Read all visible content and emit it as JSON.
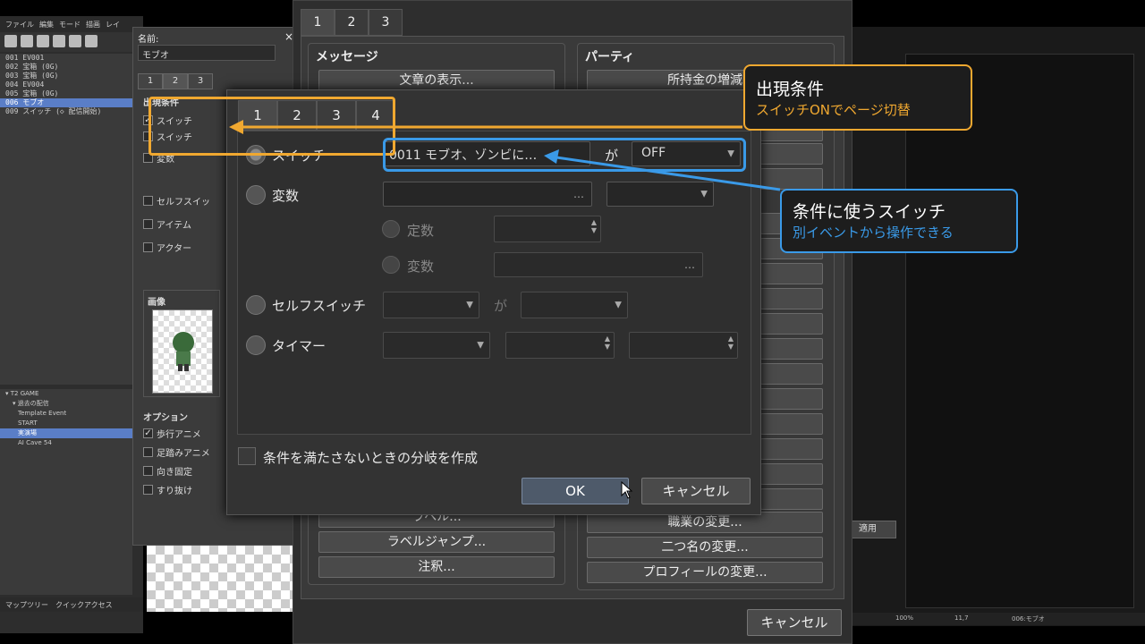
{
  "main_window": {
    "menu": [
      "ファイル",
      "編集",
      "モード",
      "描画",
      "レイ"
    ],
    "events": [
      "001 EV001",
      "002 宝箱 (0G)",
      "003 宝箱 (0G)",
      "004 EV004",
      "005 宝箱 (0G)",
      "006 モブオ",
      "009 スイッチ (◇ 配信開始)"
    ],
    "selected_event_index": 5,
    "tree": [
      "T2 GAME",
      "過去の配信",
      "Template Event",
      "START",
      "実演場",
      "AI Cave 54"
    ],
    "selected_tree_index": 4,
    "bottom_tabs": [
      "マップツリー",
      "クイックアクセス"
    ]
  },
  "event_editor": {
    "name_label": "名前:",
    "name_value": "モブオ",
    "close": "×",
    "page_tabs": [
      "1",
      "2",
      "3"
    ],
    "conditions_title": "出現条件",
    "conditions": [
      {
        "label": "スイッチ",
        "checked": true
      },
      {
        "label": "スイッチ",
        "checked": false
      },
      {
        "label": "変数",
        "checked": false
      },
      {
        "label": "セルフスイッ",
        "checked": false
      },
      {
        "label": "アイテム",
        "checked": false
      },
      {
        "label": "アクター",
        "checked": false
      }
    ],
    "image_title": "画像",
    "options_title": "オプション",
    "options": [
      {
        "label": "歩行アニメ",
        "checked": true
      },
      {
        "label": "足踏みアニメ",
        "checked": false
      },
      {
        "label": "向き固定",
        "checked": false
      },
      {
        "label": "すり抜け",
        "checked": false
      }
    ]
  },
  "command_dialog": {
    "tabs": [
      "1",
      "2",
      "3"
    ],
    "message_group": "メッセージ",
    "party_group": "パーティ",
    "left_buttons_top": [
      "文章の表示..."
    ],
    "right_buttons_top": [
      "所持金の増減"
    ],
    "left_buttons_bottom": [
      "ラベル...",
      "ラベルジャンプ...",
      "注釈..."
    ],
    "right_buttons_bottom": [
      "職業の変更...",
      "二つ名の変更...",
      "プロフィールの変更..."
    ],
    "cancel": "キャンセル"
  },
  "condition_dialog": {
    "tabs": [
      "1",
      "2",
      "3",
      "4"
    ],
    "switch_label": "スイッチ",
    "switch_value": "0011 モブオ、ゾンビに…",
    "switch_dots": "…",
    "ga": "が",
    "switch_state": "OFF",
    "variable_label": "変数",
    "constant_label": "定数",
    "variable_sub_label": "変数",
    "selfswitch_label": "セルフスイッチ",
    "selfswitch_ga": "が",
    "timer_label": "タイマー",
    "branch_label": "条件を満たさないときの分岐を作成",
    "ok": "OK",
    "cancel": "キャンセル"
  },
  "right_window": {
    "apply": "適用",
    "status": [
      "100%",
      "11,7",
      "006:モブオ"
    ]
  },
  "callouts": {
    "orange_title": "出現条件",
    "orange_sub": "スイッチONでページ切替",
    "blue_title": "条件に使うスイッチ",
    "blue_sub": "別イベントから操作できる"
  },
  "colors": {
    "orange": "#f0a830",
    "blue": "#3a9ae8",
    "selection": "#5a7ec7"
  }
}
